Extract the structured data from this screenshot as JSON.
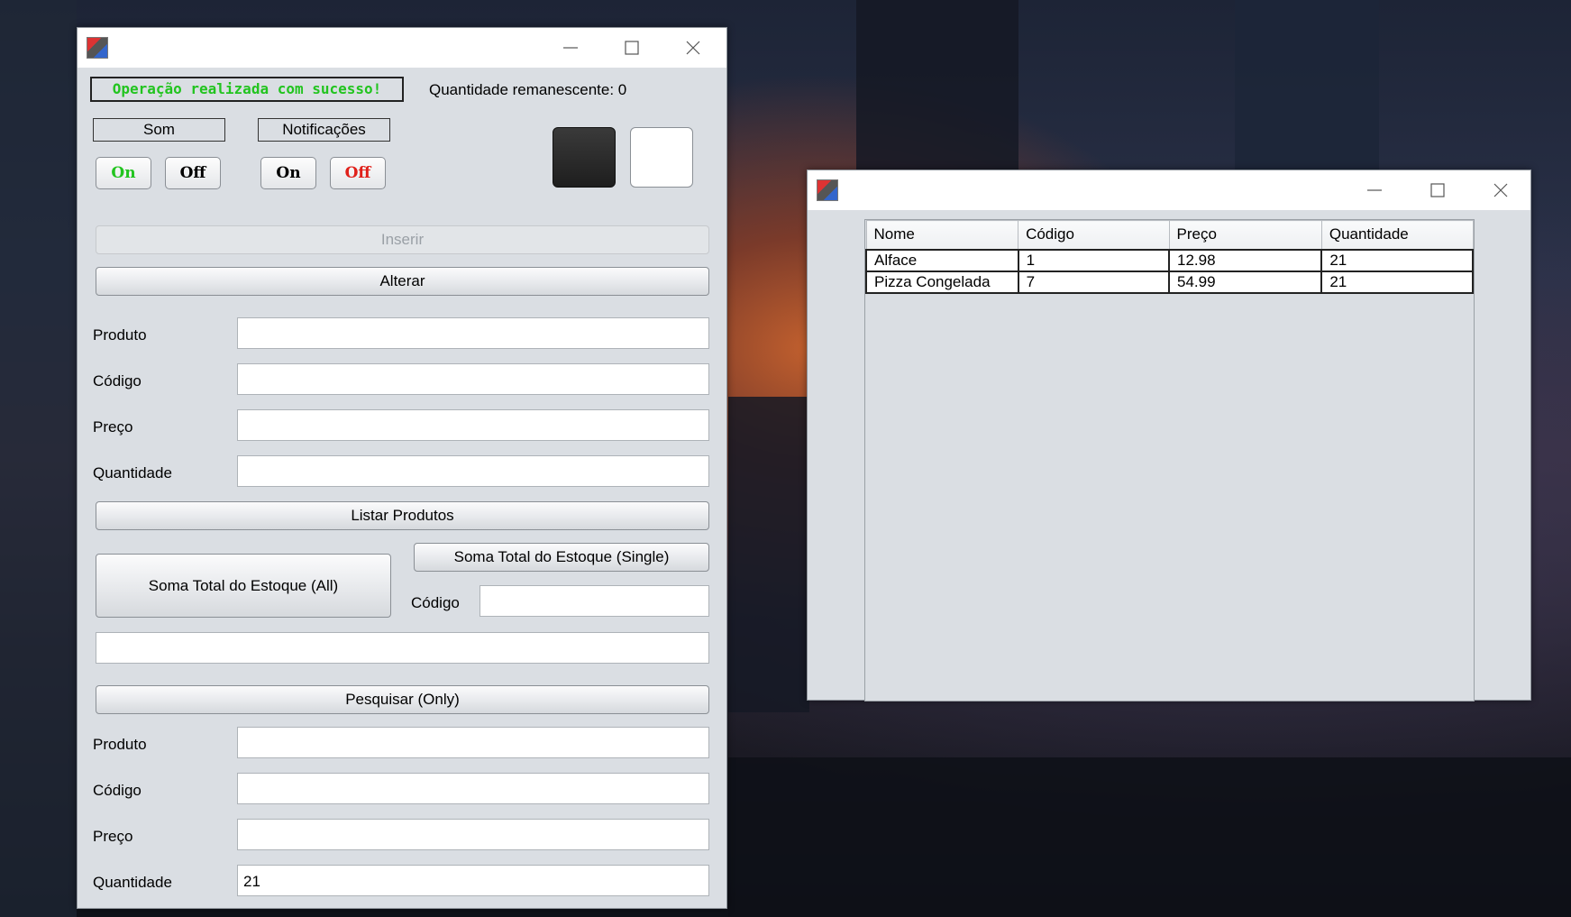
{
  "main_window": {
    "status_message": "Operação realizada com sucesso!",
    "quantity_remaining": "Quantidade remanescente: 0",
    "sound": {
      "label": "Som",
      "on": "On",
      "off": "Off"
    },
    "notifications": {
      "label": "Notificações",
      "on": "On",
      "off": "Off"
    },
    "insert_button": "Inserir",
    "alter_button": "Alterar",
    "form_top": {
      "product_label": "Produto",
      "product_value": "",
      "code_label": "Código",
      "code_value": "",
      "price_label": "Preço",
      "price_value": "",
      "quantity_label": "Quantidade",
      "quantity_value": ""
    },
    "list_button": "Listar Produtos",
    "sum_all_button": "Soma Total do Estoque (All)",
    "sum_single_button": "Soma Total do Estoque (Single)",
    "sum_code_label": "Código",
    "sum_code_value": "",
    "result_value": "",
    "search_button": "Pesquisar (Only)",
    "form_bottom": {
      "product_label": "Produto",
      "product_value": "",
      "code_label": "Código",
      "code_value": "",
      "price_label": "Preço",
      "price_value": "",
      "quantity_label": "Quantidade",
      "quantity_value": "21"
    },
    "colors": {
      "success": "#22c41f",
      "off_active": "#e0201a",
      "dark_swatch": "#2c2c2c",
      "light_swatch": "#ffffff"
    }
  },
  "table_window": {
    "columns": [
      "Nome",
      "Código",
      "Preço",
      "Quantidade"
    ],
    "rows": [
      [
        "Alface",
        "1",
        "12.98",
        "21"
      ],
      [
        "Pizza Congelada",
        "7",
        "54.99",
        "21"
      ]
    ]
  },
  "icons": [
    "app-icon",
    "minimize-icon",
    "maximize-icon",
    "close-icon"
  ]
}
